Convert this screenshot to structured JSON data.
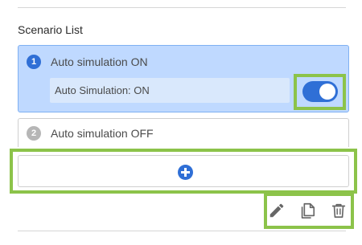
{
  "section": {
    "title": "Scenario List"
  },
  "scenarios": [
    {
      "index": "1",
      "title": "Auto simulation ON",
      "sub_label": "Auto Simulation: ON",
      "toggle_on": true,
      "active": true
    },
    {
      "index": "2",
      "title": "Auto simulation OFF",
      "active": false
    }
  ],
  "icons": {
    "add": "plus-circle-icon",
    "edit": "pencil-icon",
    "copy": "copy-icon",
    "delete": "trash-icon"
  },
  "colors": {
    "accent": "#2f6fd6",
    "active_card_bg": "#bfd9ff",
    "highlight": "#8cc34a",
    "inactive_badge": "#b6b6b6"
  }
}
